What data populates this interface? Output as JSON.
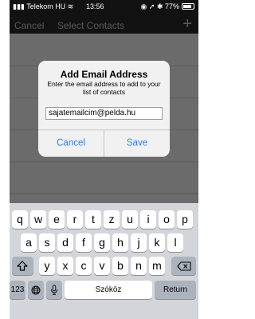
{
  "status": {
    "carrier": "Telekom HU",
    "time": "13:56",
    "battery": "77%"
  },
  "nav": {
    "cancel": "Cancel",
    "title": "Select Contacts",
    "add_icon": "plus-icon"
  },
  "alert": {
    "title": "Add Email Address",
    "message": "Enter the email address to add to your list of contacts",
    "input_value": "sajatemailcim@pelda.hu",
    "cancel": "Cancel",
    "save": "Save"
  },
  "keyboard": {
    "row1": [
      "q",
      "w",
      "e",
      "r",
      "t",
      "z",
      "u",
      "i",
      "o",
      "p"
    ],
    "row2": [
      "a",
      "s",
      "d",
      "f",
      "g",
      "h",
      "j",
      "k",
      "l"
    ],
    "row3": [
      "y",
      "x",
      "c",
      "v",
      "b",
      "n",
      "m"
    ],
    "numbers": "123",
    "space": "Szóköz",
    "return": "Return"
  },
  "colors": {
    "accent": "#2f7cf6",
    "status_bar": "#121212",
    "overlay": "#6b6b6b",
    "keyboard_bg": "#d3d5da"
  }
}
